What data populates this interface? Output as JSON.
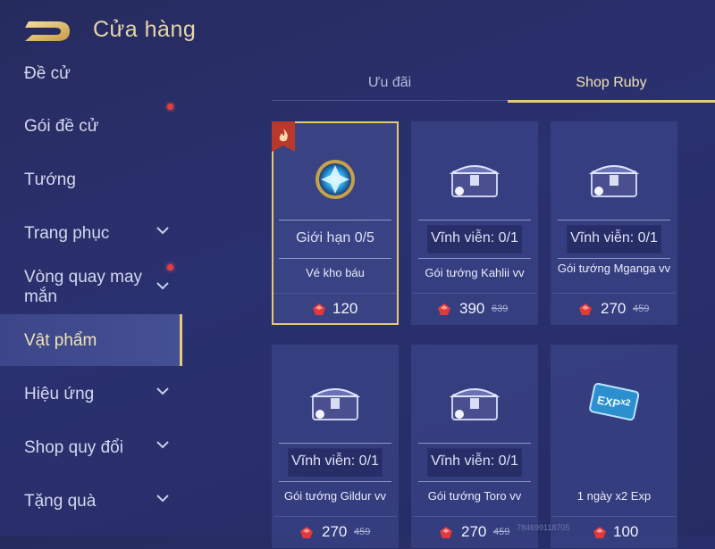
{
  "header": {
    "title": "Cửa hàng"
  },
  "sidebar": {
    "items": [
      {
        "label": "Đề cử"
      },
      {
        "label": "Gói đề cử"
      },
      {
        "label": "Tướng"
      },
      {
        "label": "Trang phục"
      },
      {
        "label": "Vòng quay may mắn"
      },
      {
        "label": "Vật phẩm"
      },
      {
        "label": "Hiệu ứng"
      },
      {
        "label": "Shop quy đổi"
      },
      {
        "label": "Tặng quà"
      }
    ]
  },
  "tabs": [
    {
      "label": "Ưu đãi"
    },
    {
      "label": "Shop Ruby"
    }
  ],
  "cards": [
    {
      "limit": "Giới hạn 0/5",
      "name": "Vé kho báu",
      "price": "120",
      "old_price": ""
    },
    {
      "limit": "Vĩnh viễn: 0/1",
      "name": "Gói tướng Kahlii vv",
      "price": "390",
      "old_price": "639"
    },
    {
      "limit": "Vĩnh viễn: 0/1",
      "name": "Gói tướng Mganga vv",
      "price": "270",
      "old_price": "459"
    },
    {
      "limit": "Vĩnh viễn: 0/1",
      "name": "Gói tướng Gildur vv",
      "price": "270",
      "old_price": "459"
    },
    {
      "limit": "Vĩnh viễn: 0/1",
      "name": "Gói tướng Toro vv",
      "price": "270",
      "old_price": "459"
    },
    {
      "limit": "",
      "name": "1 ngày x2 Exp",
      "price": "100",
      "old_price": ""
    }
  ],
  "exp_card_text": {
    "exp": "EXP",
    "mult": "x2"
  },
  "watermark": "784699118705",
  "colors": {
    "accent_gold": "#e9c97a",
    "ruby": "#e23a3a",
    "notify_dot": "#e53d3d"
  }
}
